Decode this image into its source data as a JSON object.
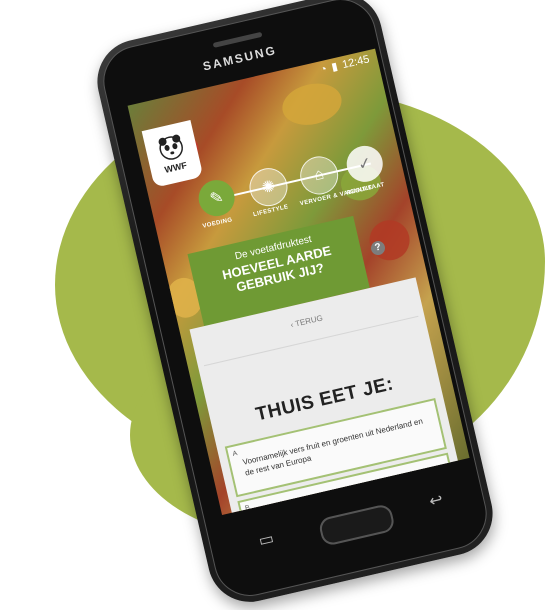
{
  "device": {
    "brand": "SAMSUNG",
    "time": "12:45"
  },
  "app": {
    "logo_text": "WWF",
    "steps": [
      {
        "label": "VOEDING",
        "state": "active"
      },
      {
        "label": "LIFESTYLE",
        "state": "idle"
      },
      {
        "label": "VERVOER & VAKANTIE",
        "state": "idle"
      },
      {
        "label": "RESULTAAT",
        "state": "done"
      }
    ],
    "test_card": {
      "subtitle": "De voetafdruktest",
      "title": "HOEVEEL AARDE GEBRUIK JIJ?"
    },
    "help_label": "?",
    "back_label": "‹ TERUG",
    "question": "THUIS EET JE:",
    "answers": [
      {
        "letter": "A",
        "text": "Voornamelijk vers fruit en groenten uit Nederland en de rest van Europa"
      },
      {
        "letter": "B",
        "text": ""
      }
    ]
  },
  "colors": {
    "accent_green": "#6f9a34",
    "blob_green": "#a5b94b"
  }
}
